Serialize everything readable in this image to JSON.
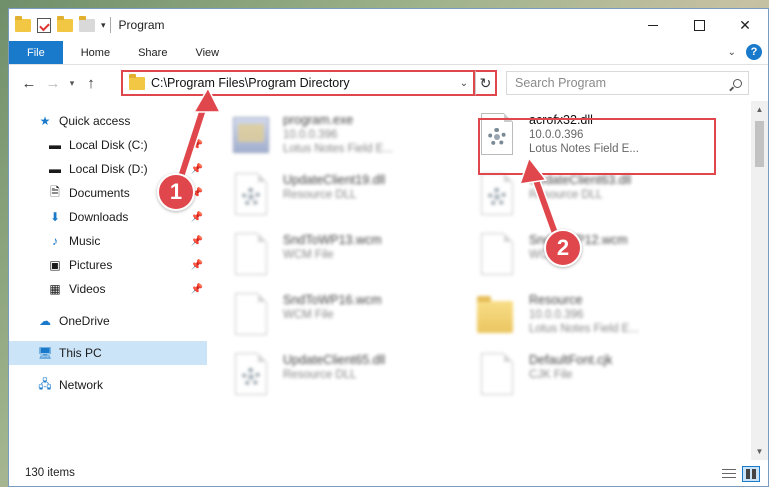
{
  "window": {
    "title": "Program"
  },
  "ribbon": {
    "tabs": [
      "File",
      "Home",
      "Share",
      "View"
    ]
  },
  "address": {
    "path": "C:\\Program Files\\Program Directory"
  },
  "search": {
    "placeholder": "Search Program"
  },
  "nav": {
    "quick_access": "Quick access",
    "items": [
      {
        "label": "Local Disk (C:)",
        "icon": "drive-icon"
      },
      {
        "label": "Local Disk (D:)",
        "icon": "drive-icon"
      },
      {
        "label": "Documents",
        "icon": "documents-icon"
      },
      {
        "label": "Downloads",
        "icon": "downloads-icon"
      },
      {
        "label": "Music",
        "icon": "music-icon"
      },
      {
        "label": "Pictures",
        "icon": "pictures-icon"
      },
      {
        "label": "Videos",
        "icon": "videos-icon"
      }
    ],
    "onedrive": "OneDrive",
    "this_pc": "This PC",
    "network": "Network"
  },
  "files": [
    {
      "name": "program.exe",
      "line2": "10.0.0.396",
      "line3": "Lotus Notes Field E...",
      "icon": "exe-icon"
    },
    {
      "name": "acrofx32.dll",
      "line2": "10.0.0.396",
      "line3": "Lotus Notes Field E...",
      "icon": "dll-gear-icon"
    },
    {
      "name": "UpdateClient19.dll",
      "line2": "Resource DLL",
      "icon": "dll-gear-icon"
    },
    {
      "name": "UpdateClient63.dll",
      "line2": "Resource DLL",
      "icon": "dll-gear-icon"
    },
    {
      "name": "SndToWP13.wcm",
      "line2": "WCM File",
      "icon": "document-icon"
    },
    {
      "name": "SndToWP12.wcm",
      "line2": "WCM File",
      "icon": "document-icon"
    },
    {
      "name": "SndToWP16.wcm",
      "line2": "WCM File",
      "icon": "document-icon"
    },
    {
      "name": "Resource",
      "line2": "10.0.0.396",
      "line3": "Lotus Notes Field E...",
      "icon": "folder-icon"
    },
    {
      "name": "UpdateClient65.dll",
      "line2": "Resource DLL",
      "icon": "dll-gear-icon"
    },
    {
      "name": "DefaultFont.cjk",
      "line2": "CJK File",
      "icon": "document-icon"
    }
  ],
  "status": {
    "items_count": "130 items"
  },
  "annotations": {
    "badge1": "1",
    "badge2": "2"
  },
  "colors": {
    "accent": "#1979ca",
    "highlight": "#e0474c",
    "selected": "#cce4f7"
  }
}
